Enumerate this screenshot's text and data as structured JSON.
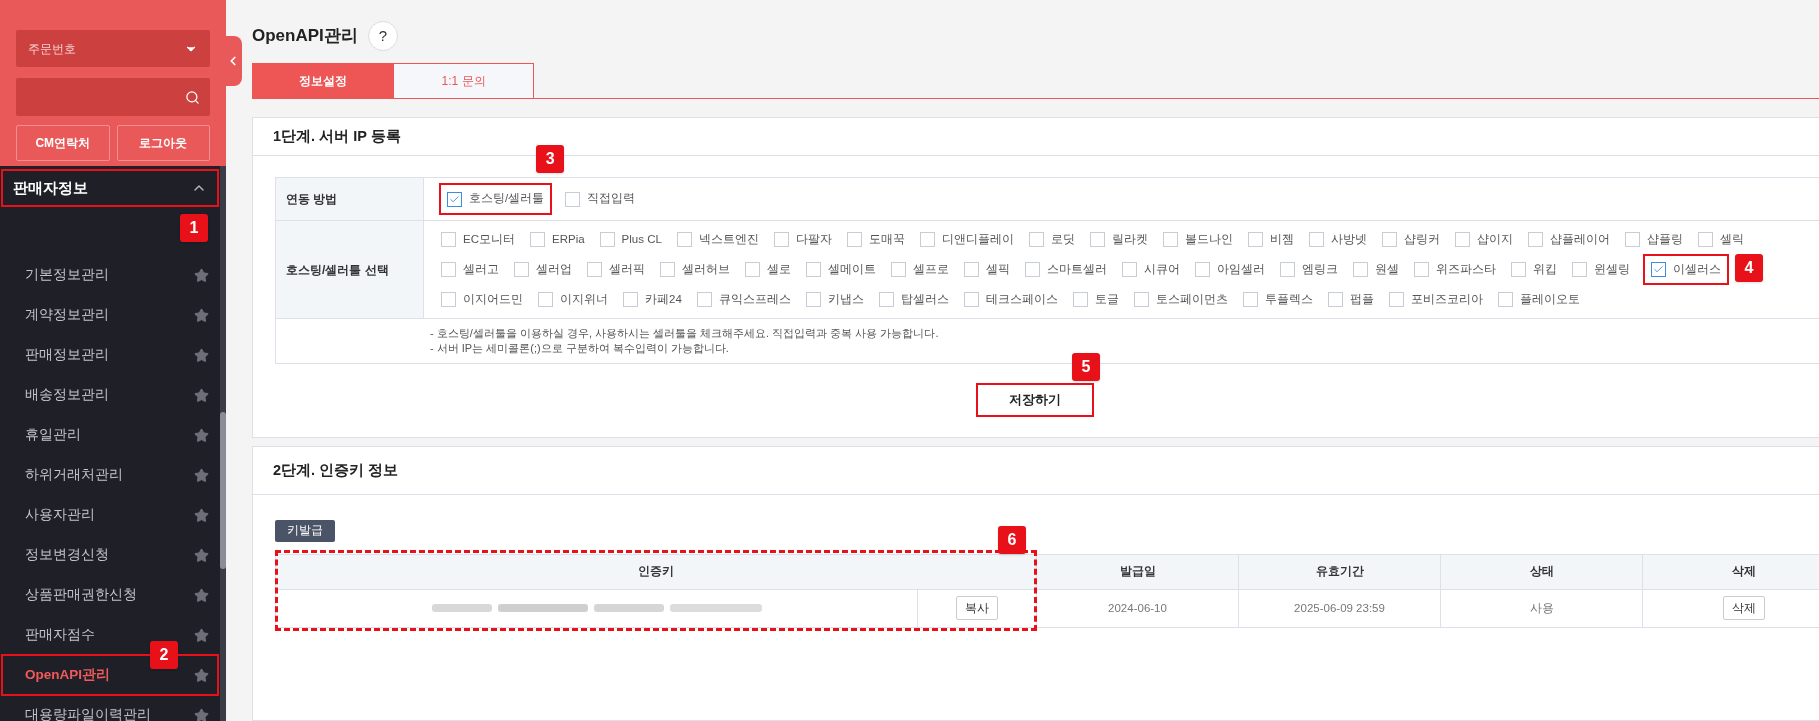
{
  "sidebar": {
    "order_select": "주문번호",
    "buttons": [
      "CM연락처",
      "로그아웃"
    ],
    "section": {
      "title": "판매자정보",
      "expanded": true,
      "badge": "1",
      "items": [
        {
          "label": "기본정보관리",
          "selected": false
        },
        {
          "label": "계약정보관리",
          "selected": false
        },
        {
          "label": "판매정보관리",
          "selected": false
        },
        {
          "label": "배송정보관리",
          "selected": false
        },
        {
          "label": "휴일관리",
          "selected": false
        },
        {
          "label": "하위거래처관리",
          "selected": false
        },
        {
          "label": "사용자관리",
          "selected": false
        },
        {
          "label": "정보변경신청",
          "selected": false
        },
        {
          "label": "상품판매권한신청",
          "selected": false
        },
        {
          "label": "판매자점수",
          "selected": false
        },
        {
          "label": "OpenAPI관리",
          "selected": true,
          "badge": "2"
        },
        {
          "label": "대용량파일이력관리",
          "selected": false
        }
      ]
    }
  },
  "page": {
    "title": "OpenAPI관리",
    "help": "?"
  },
  "tabs": [
    {
      "label": "정보설정",
      "selected": true
    },
    {
      "label": "1:1 문의",
      "selected": false
    }
  ],
  "step1": {
    "title": "1단계. 서버 IP 등록",
    "method": {
      "label": "연동 방법",
      "options": [
        {
          "label": "호스팅/셀러툴",
          "checked": true,
          "badge": "3"
        },
        {
          "label": "직접입력",
          "checked": false
        }
      ]
    },
    "tools": {
      "label": "호스팅/셀러툴 선택",
      "options": [
        {
          "label": "EC모니터",
          "checked": false
        },
        {
          "label": "ERPia",
          "checked": false
        },
        {
          "label": "Plus CL",
          "checked": false
        },
        {
          "label": "넥스트엔진",
          "checked": false
        },
        {
          "label": "다팔자",
          "checked": false
        },
        {
          "label": "도매꾹",
          "checked": false
        },
        {
          "label": "디앤디플레이",
          "checked": false
        },
        {
          "label": "로딧",
          "checked": false
        },
        {
          "label": "릴라켓",
          "checked": false
        },
        {
          "label": "볼드나인",
          "checked": false
        },
        {
          "label": "비젬",
          "checked": false
        },
        {
          "label": "사방넷",
          "checked": false
        },
        {
          "label": "샵링커",
          "checked": false
        },
        {
          "label": "샵이지",
          "checked": false
        },
        {
          "label": "샵플레이어",
          "checked": false
        },
        {
          "label": "샵플링",
          "checked": false
        },
        {
          "label": "셀릭",
          "checked": false
        },
        {
          "label": "셀러고",
          "checked": false
        },
        {
          "label": "셀러업",
          "checked": false
        },
        {
          "label": "셀러픽",
          "checked": false
        },
        {
          "label": "셀러허브",
          "checked": false
        },
        {
          "label": "셀로",
          "checked": false
        },
        {
          "label": "셀메이트",
          "checked": false
        },
        {
          "label": "셀프로",
          "checked": false
        },
        {
          "label": "셀픽",
          "checked": false
        },
        {
          "label": "스마트셀러",
          "checked": false
        },
        {
          "label": "시큐어",
          "checked": false
        },
        {
          "label": "아임셀러",
          "checked": false
        },
        {
          "label": "엠링크",
          "checked": false
        },
        {
          "label": "원셀",
          "checked": false
        },
        {
          "label": "위즈파스타",
          "checked": false
        },
        {
          "label": "위킵",
          "checked": false
        },
        {
          "label": "윈셀링",
          "checked": false
        },
        {
          "label": "이셀러스",
          "checked": true,
          "badge": "4"
        },
        {
          "label": "이지어드민",
          "checked": false
        },
        {
          "label": "이지위너",
          "checked": false
        },
        {
          "label": "카페24",
          "checked": false
        },
        {
          "label": "큐익스프레스",
          "checked": false
        },
        {
          "label": "키냅스",
          "checked": false
        },
        {
          "label": "탑셀러스",
          "checked": false
        },
        {
          "label": "테크스페이스",
          "checked": false
        },
        {
          "label": "토글",
          "checked": false
        },
        {
          "label": "토스페이먼츠",
          "checked": false
        },
        {
          "label": "투플렉스",
          "checked": false
        },
        {
          "label": "펍플",
          "checked": false
        },
        {
          "label": "포비즈코리아",
          "checked": false
        },
        {
          "label": "플레이오토",
          "checked": false
        }
      ]
    },
    "notes": [
      "- 호스팅/셀러툴을 이용하실 경우, 사용하시는 셀러툴을 체크해주세요. 직접입력과 중복 사용 가능합니다.",
      "- 서버 IP는 세미콜론(;)으로 구분하여 복수입력이 가능합니다."
    ],
    "save": {
      "label": "저장하기",
      "badge": "5"
    }
  },
  "step2": {
    "title": "2단계. 인증키 정보",
    "issue_button": "키발급",
    "table": {
      "badge": "6",
      "columns": [
        "인증키",
        "발급일",
        "유효기간",
        "상태",
        "삭제"
      ],
      "rows": [
        {
          "copy": "복사",
          "issued": "2024-06-10",
          "expires": "2025-06-09 23:59",
          "status": "사용",
          "delete": "삭제"
        }
      ]
    }
  }
}
